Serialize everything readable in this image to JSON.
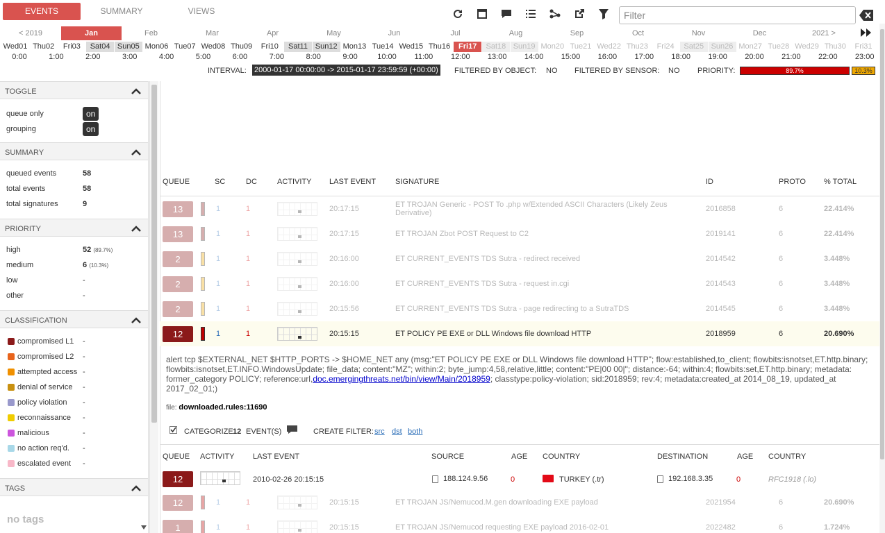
{
  "tabs": [
    {
      "label": "EVENTS",
      "active": true
    },
    {
      "label": "SUMMARY",
      "active": false
    },
    {
      "label": "VIEWS",
      "active": false
    }
  ],
  "toolbar": {
    "icons": [
      "refresh-icon",
      "maximize-icon",
      "comment-icon",
      "list-icon",
      "graph-icon",
      "external-link-icon",
      "funnel-icon"
    ]
  },
  "filter": {
    "placeholder": "Filter",
    "value": ""
  },
  "timeline": {
    "months": [
      "< 2019",
      "Jan",
      "Feb",
      "Mar",
      "Apr",
      "May",
      "Jun",
      "Jul",
      "Aug",
      "Sep",
      "Oct",
      "Nov",
      "Dec",
      "2021 >"
    ],
    "active_month": "Jan",
    "days": [
      "Wed01",
      "Thu02",
      "Fri03",
      "Sat04",
      "Sun05",
      "Mon06",
      "Tue07",
      "Wed08",
      "Thu09",
      "Fri10",
      "Sat11",
      "Sun12",
      "Mon13",
      "Tue14",
      "Wed15",
      "Thu16",
      "Fri17",
      "Sat18",
      "Sun19",
      "Mon20",
      "Tue21",
      "Wed22",
      "Thu23",
      "Fri24",
      "Sat25",
      "Sun26",
      "Mon27",
      "Tue28",
      "Wed29",
      "Thu30",
      "Fri31"
    ],
    "active_day": "Fri17",
    "hours": [
      "0:00",
      "1:00",
      "2:00",
      "3:00",
      "4:00",
      "5:00",
      "6:00",
      "7:00",
      "8:00",
      "9:00",
      "10:00",
      "11:00",
      "12:00",
      "13:00",
      "14:00",
      "15:00",
      "16:00",
      "17:00",
      "18:00",
      "19:00",
      "20:00",
      "21:00",
      "22:00",
      "23:00"
    ]
  },
  "status": {
    "interval_label": "INTERVAL:",
    "interval_value": "2000-01-17 00:00:00 -> 2015-01-17 23:59:59 (+00:00)",
    "filtered_object_label": "FILTERED BY OBJECT:",
    "filtered_object_value": "NO",
    "filtered_sensor_label": "FILTERED BY SENSOR:",
    "filtered_sensor_value": "NO",
    "priority_label": "PRIORITY:",
    "priority_high": "89.7%",
    "priority_medium": "10.3%"
  },
  "sidebar": {
    "toggle": {
      "title": "TOGGLE",
      "items": [
        {
          "label": "queue only",
          "value": "on"
        },
        {
          "label": "grouping",
          "value": "on"
        }
      ]
    },
    "summary": {
      "title": "SUMMARY",
      "items": [
        {
          "label": "queued events",
          "value": "58"
        },
        {
          "label": "total events",
          "value": "58"
        },
        {
          "label": "total signatures",
          "value": "9"
        }
      ]
    },
    "priority": {
      "title": "PRIORITY",
      "items": [
        {
          "label": "high",
          "value": "52",
          "pct": "(89.7%)"
        },
        {
          "label": "medium",
          "value": "6",
          "pct": "(10.3%)"
        },
        {
          "label": "low",
          "value": "-",
          "pct": ""
        },
        {
          "label": "other",
          "value": "-",
          "pct": ""
        }
      ]
    },
    "classification": {
      "title": "CLASSIFICATION",
      "items": [
        {
          "label": "compromised L1",
          "value": "-",
          "color": "#8b1a1a"
        },
        {
          "label": "compromised L2",
          "value": "-",
          "color": "#e8641c"
        },
        {
          "label": "attempted access",
          "value": "-",
          "color": "#f09000"
        },
        {
          "label": "denial of service",
          "value": "-",
          "color": "#c89010"
        },
        {
          "label": "policy violation",
          "value": "-",
          "color": "#9999cc"
        },
        {
          "label": "reconnaissance",
          "value": "-",
          "color": "#f0cc00"
        },
        {
          "label": "malicious",
          "value": "-",
          "color": "#cc55dd"
        },
        {
          "label": "no action req'd.",
          "value": "-",
          "color": "#a8d8e8"
        },
        {
          "label": "escalated event",
          "value": "-",
          "color": "#f8b8c8"
        }
      ]
    },
    "tags": {
      "title": "TAGS",
      "empty": "no tags"
    }
  },
  "table": {
    "headers": {
      "queue": "QUEUE",
      "sc": "SC",
      "dc": "DC",
      "activity": "ACTIVITY",
      "last_event": "LAST EVENT",
      "signature": "SIGNATURE",
      "id": "ID",
      "proto": "PROTO",
      "total": "% TOTAL"
    },
    "rows": [
      {
        "queue": "13",
        "sc": "1",
        "dc": "1",
        "last": "20:17:15",
        "sig": "ET TROJAN Generic - POST To .php w/Extended ASCII Characters (Likely Zeus",
        "sig2": "Derivative)",
        "id": "2016858",
        "proto": "6",
        "total": "22.414%",
        "color": "#8b1a1a",
        "dim": true
      },
      {
        "queue": "13",
        "sc": "1",
        "dc": "1",
        "last": "20:17:15",
        "sig": "ET TROJAN Zbot POST Request to C2",
        "sig2": "",
        "id": "2019141",
        "proto": "6",
        "total": "22.414%",
        "color": "#8b1a1a",
        "dim": true
      },
      {
        "queue": "2",
        "sc": "1",
        "dc": "1",
        "last": "20:16:00",
        "sig": "ET CURRENT_EVENTS TDS Sutra - redirect received",
        "sig2": "",
        "id": "2014542",
        "proto": "6",
        "total": "3.448%",
        "color": "#f0a800",
        "dim": true
      },
      {
        "queue": "2",
        "sc": "1",
        "dc": "1",
        "last": "20:16:00",
        "sig": "ET CURRENT_EVENTS TDS Sutra - request in.cgi",
        "sig2": "",
        "id": "2014543",
        "proto": "6",
        "total": "3.448%",
        "color": "#f0a800",
        "dim": true
      },
      {
        "queue": "2",
        "sc": "1",
        "dc": "1",
        "last": "20:15:56",
        "sig": "ET CURRENT_EVENTS TDS Sutra - page redirecting to a SutraTDS",
        "sig2": "",
        "id": "2014545",
        "proto": "6",
        "total": "3.448%",
        "color": "#f0a800",
        "dim": true
      },
      {
        "queue": "12",
        "sc": "1",
        "dc": "1",
        "last": "20:15:15",
        "sig": "ET POLICY PE EXE or DLL Windows file download HTTP",
        "sig2": "",
        "id": "2018959",
        "proto": "6",
        "total": "20.690%",
        "color": "#c00000",
        "dim": false
      }
    ]
  },
  "detail": {
    "rule_pre": "alert tcp $EXTERNAL_NET $HTTP_PORTS -> $HOME_NET any (msg:\"ET POLICY PE EXE or DLL Windows file download HTTP\"; flow:established,to_client; flowbits:isnotset,ET.http.binary; flowbits:isnotset,ET.INFO.WindowsUpdate; file_data; content:\"MZ\"; within:2; byte_jump:4,58,relative,little; content:\"PE|00 00|\"; distance:-64; within:4; flowbits:set,ET.http.binary; metadata: former_category POLICY; reference:url,",
    "rule_link": "doc.emergingthreats.net/bin/view/Main/2018959",
    "rule_post": "; classtype:policy-violation; sid:2018959; rev:4; metadata:created_at 2014_08_19, updated_at 2017_02_01;)",
    "file_label": "file:",
    "file_value": "downloaded.rules:11690",
    "categorize_label": "CATEGORIZE",
    "categorize_count": "12",
    "events_label": "EVENT(S)",
    "create_filter_label": "CREATE FILTER:",
    "filter_src": "src",
    "filter_dst": "dst",
    "filter_both": "both"
  },
  "subtable": {
    "headers": {
      "queue": "QUEUE",
      "activity": "ACTIVITY",
      "last_event": "LAST EVENT",
      "source": "SOURCE",
      "age": "AGE",
      "country": "COUNTRY",
      "destination": "DESTINATION",
      "age2": "AGE",
      "country2": "COUNTRY"
    },
    "row": {
      "queue": "12",
      "last": "2010-02-26 20:15:15",
      "source": "188.124.9.56",
      "age": "0",
      "country": "TURKEY (.tr)",
      "dest": "192.168.3.35",
      "age2": "0",
      "country2": "RFC1918 (.lo)"
    }
  },
  "trailing_rows": [
    {
      "queue": "12",
      "sc": "1",
      "dc": "1",
      "last": "20:15:15",
      "sig": "ET TROJAN JS/Nemucod.M.gen downloading EXE payload",
      "id": "2021954",
      "proto": "6",
      "total": "20.690%",
      "color": "#c00000"
    },
    {
      "queue": "1",
      "sc": "1",
      "dc": "1",
      "last": "20:15:15",
      "sig": "ET TROJAN JS/Nemucod requesting EXE payload 2016-02-01",
      "id": "2022482",
      "proto": "6",
      "total": "1.724%",
      "color": "#c00000"
    }
  ]
}
